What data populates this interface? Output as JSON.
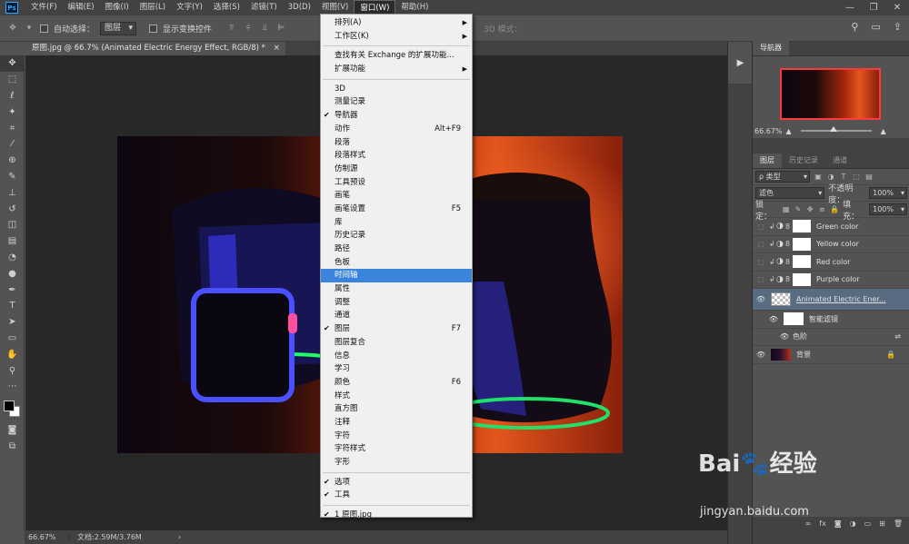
{
  "app": {
    "logo": "Ps"
  },
  "menubar": {
    "items": [
      "文件(F)",
      "编辑(E)",
      "图像(I)",
      "图层(L)",
      "文字(Y)",
      "选择(S)",
      "滤镜(T)",
      "3D(D)",
      "视图(V)",
      "窗口(W)",
      "帮助(H)"
    ],
    "active_index": 9
  },
  "window_controls": [
    "—",
    "❐",
    "✕"
  ],
  "options": {
    "auto_select_label": "自动选择：",
    "auto_select_value": "图层",
    "show_transform_label": "显示变换控件",
    "mode3d_label": "3D 模式："
  },
  "doc_tab": {
    "title": "原图.jpg @ 66.7% (Animated Electric Energy Effect, RGB/8) *",
    "close": "×"
  },
  "status": {
    "zoom": "66.67%",
    "doc": "文档:2.59M/3.76M",
    "arrow": "›"
  },
  "navigator": {
    "tab": "导航器",
    "zoom": "66.67%"
  },
  "layers_panel": {
    "tabs": [
      "图层",
      "历史记录",
      "通道"
    ],
    "filter_kind": "ρ 类型",
    "blend_mode": "滤色",
    "opacity_label": "不透明度：",
    "opacity_value": "100%",
    "lock_label": "锁定：",
    "fill_label": "填充：",
    "fill_value": "100%",
    "layers": [
      {
        "name": "Green color"
      },
      {
        "name": "Yellow color"
      },
      {
        "name": "Red color"
      },
      {
        "name": "Purple color"
      },
      {
        "name": "Animated Electric Ener..."
      },
      {
        "name": "智能滤镜"
      },
      {
        "name": "色阶"
      },
      {
        "name": "背景"
      }
    ]
  },
  "dropdown": {
    "groups": [
      [
        {
          "label": "排列(A)",
          "sub": true
        },
        {
          "label": "工作区(K)",
          "sub": true
        }
      ],
      [
        {
          "label": "查找有关 Exchange 的扩展功能..."
        },
        {
          "label": "扩展功能",
          "sub": true
        }
      ],
      [
        {
          "label": "3D"
        },
        {
          "label": "测量记录"
        },
        {
          "label": "导航器",
          "checked": true
        },
        {
          "label": "动作",
          "shortcut": "Alt+F9"
        },
        {
          "label": "段落"
        },
        {
          "label": "段落样式"
        },
        {
          "label": "仿制源"
        },
        {
          "label": "工具预设"
        },
        {
          "label": "画笔"
        },
        {
          "label": "画笔设置",
          "shortcut": "F5"
        },
        {
          "label": "库"
        },
        {
          "label": "历史记录"
        },
        {
          "label": "路径"
        },
        {
          "label": "色板"
        },
        {
          "label": "时间轴",
          "highlight": true
        },
        {
          "label": "属性"
        },
        {
          "label": "调整"
        },
        {
          "label": "通道"
        },
        {
          "label": "图层",
          "checked": true,
          "shortcut": "F7"
        },
        {
          "label": "图层复合"
        },
        {
          "label": "信息"
        },
        {
          "label": "学习"
        },
        {
          "label": "颜色",
          "shortcut": "F6"
        },
        {
          "label": "样式"
        },
        {
          "label": "直方图"
        },
        {
          "label": "注释"
        },
        {
          "label": "字符"
        },
        {
          "label": "字符样式"
        },
        {
          "label": "字形"
        }
      ],
      [
        {
          "label": "选项",
          "checked": true
        },
        {
          "label": "工具",
          "checked": true
        }
      ],
      [
        {
          "label": "1 原图.jpg",
          "checked": true
        }
      ]
    ]
  },
  "watermark": {
    "main": "Bai🐾经验",
    "sub": "jingyan.baidu.com"
  }
}
